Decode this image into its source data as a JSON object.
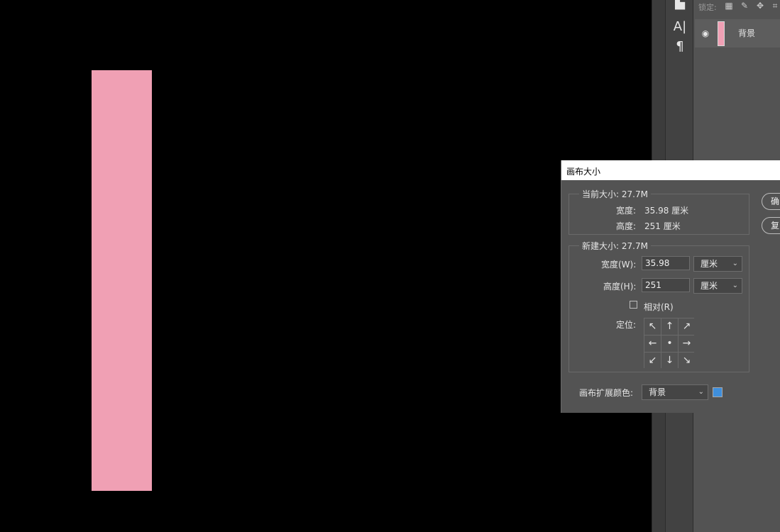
{
  "canvas": {
    "rect_color": "#f0a0b4",
    "background": "#000000"
  },
  "tools": {
    "top_icon": "document-icon",
    "text_tool": "A|",
    "paragraph_tool": "¶"
  },
  "layers": {
    "lock_label": "锁定:",
    "lock_icons": [
      "lock-transparent-icon",
      "lock-paint-icon",
      "lock-move-icon",
      "lock-artboard-icon"
    ],
    "layer_name": "背景",
    "layer_visible": true
  },
  "dialog": {
    "title": "画布大小",
    "current_size": {
      "title": "当前大小: 27.7M",
      "width_label": "宽度:",
      "width_value": "35.98 厘米",
      "height_label": "高度:",
      "height_value": "251 厘米"
    },
    "new_size": {
      "title": "新建大小: 27.7M",
      "width_label": "宽度(W):",
      "width_value": "35.98",
      "width_unit": "厘米",
      "height_label": "高度(H):",
      "height_value": "251",
      "height_unit": "厘米",
      "relative_label": "相对(R)",
      "relative_checked": false,
      "anchor_label": "定位:",
      "anchor_arrows": [
        "↖",
        "↑",
        "↗",
        "←",
        "•",
        "→",
        "↙",
        "↓",
        "↘"
      ]
    },
    "extension_color_label": "画布扩展颜色:",
    "extension_color_value": "背景",
    "extension_color_swatch": "#3f8fdc",
    "ok_button": "确",
    "reset_button": "复"
  }
}
